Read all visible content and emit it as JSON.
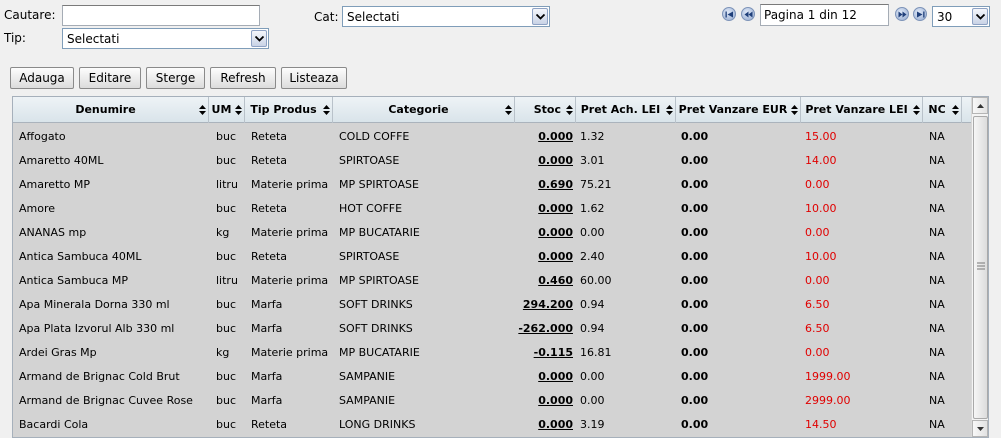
{
  "filters": {
    "search_label": "Cautare:",
    "search_value": "",
    "type_label": "Tip:",
    "type_value": "Selectati",
    "cat_label": "Cat:",
    "cat_value": "Selectati"
  },
  "pager": {
    "page_text": "Pagina 1 din 12",
    "page_size": "30"
  },
  "toolbar": {
    "add": "Adauga",
    "edit": "Editare",
    "delete": "Sterge",
    "refresh": "Refresh",
    "list": "Listeaza"
  },
  "columns": {
    "denumire": "Denumire",
    "um": "UM",
    "tip": "Tip Produs",
    "categorie": "Categorie",
    "stoc": "Stoc",
    "pret_ach": "Pret Ach. LEI",
    "pret_eur": "Pret Vanzare EUR",
    "pret_lei": "Pret Vanzare LEI",
    "nc": "NC"
  },
  "rows": [
    {
      "denumire": "Affogato",
      "um": "buc",
      "tip": "Reteta",
      "categorie": "COLD COFFE",
      "stoc": "0.000",
      "pret_ach": "1.32",
      "pret_eur": "0.00",
      "pret_lei": "15.00",
      "nc": "NA"
    },
    {
      "denumire": "Amaretto 40ML",
      "um": "buc",
      "tip": "Reteta",
      "categorie": "SPIRTOASE",
      "stoc": "0.000",
      "pret_ach": "3.01",
      "pret_eur": "0.00",
      "pret_lei": "14.00",
      "nc": "NA"
    },
    {
      "denumire": "Amaretto MP",
      "um": "litru",
      "tip": "Materie prima",
      "categorie": "MP SPIRTOASE",
      "stoc": "0.690",
      "pret_ach": "75.21",
      "pret_eur": "0.00",
      "pret_lei": "0.00",
      "nc": "NA"
    },
    {
      "denumire": "Amore",
      "um": "buc",
      "tip": "Reteta",
      "categorie": "HOT COFFE",
      "stoc": "0.000",
      "pret_ach": "1.62",
      "pret_eur": "0.00",
      "pret_lei": "10.00",
      "nc": "NA"
    },
    {
      "denumire": "ANANAS mp",
      "um": "kg",
      "tip": "Materie prima",
      "categorie": "MP BUCATARIE",
      "stoc": "0.000",
      "pret_ach": "0.00",
      "pret_eur": "0.00",
      "pret_lei": "0.00",
      "nc": "NA"
    },
    {
      "denumire": "Antica Sambuca 40ML",
      "um": "buc",
      "tip": "Reteta",
      "categorie": "SPIRTOASE",
      "stoc": "0.000",
      "pret_ach": "2.40",
      "pret_eur": "0.00",
      "pret_lei": "10.00",
      "nc": "NA"
    },
    {
      "denumire": "Antica Sambuca MP",
      "um": "litru",
      "tip": "Materie prima",
      "categorie": "MP SPIRTOASE",
      "stoc": "0.460",
      "pret_ach": "60.00",
      "pret_eur": "0.00",
      "pret_lei": "0.00",
      "nc": "NA"
    },
    {
      "denumire": "Apa Minerala Dorna 330 ml",
      "um": "buc",
      "tip": "Marfa",
      "categorie": "SOFT DRINKS",
      "stoc": "294.200",
      "pret_ach": "0.94",
      "pret_eur": "0.00",
      "pret_lei": "6.50",
      "nc": "NA"
    },
    {
      "denumire": "Apa Plata Izvorul Alb 330 ml",
      "um": "buc",
      "tip": "Marfa",
      "categorie": "SOFT DRINKS",
      "stoc": "-262.000",
      "pret_ach": "0.94",
      "pret_eur": "0.00",
      "pret_lei": "6.50",
      "nc": "NA"
    },
    {
      "denumire": "Ardei Gras Mp",
      "um": "kg",
      "tip": "Materie prima",
      "categorie": "MP BUCATARIE",
      "stoc": "-0.115",
      "pret_ach": "16.81",
      "pret_eur": "0.00",
      "pret_lei": "0.00",
      "nc": "NA"
    },
    {
      "denumire": "Armand de Brignac Cold Brut",
      "um": "buc",
      "tip": "Marfa",
      "categorie": "SAMPANIE",
      "stoc": "0.000",
      "pret_ach": "0.00",
      "pret_eur": "0.00",
      "pret_lei": "1999.00",
      "nc": "NA"
    },
    {
      "denumire": "Armand de Brignac Cuvee Rose",
      "um": "buc",
      "tip": "Marfa",
      "categorie": "SAMPANIE",
      "stoc": "0.000",
      "pret_ach": "0.00",
      "pret_eur": "0.00",
      "pret_lei": "2999.00",
      "nc": "NA"
    },
    {
      "denumire": "Bacardi Cola",
      "um": "buc",
      "tip": "Reteta",
      "categorie": "LONG DRINKS",
      "stoc": "0.000",
      "pret_ach": "3.19",
      "pret_eur": "0.00",
      "pret_lei": "14.50",
      "nc": "NA"
    }
  ],
  "icons": {
    "first": "first-page-icon",
    "prev": "prev-page-icon",
    "next": "next-page-icon",
    "last": "last-page-icon",
    "dropdown": "chevron-down-icon",
    "sort": "sort-icon"
  },
  "colors": {
    "price_lei": "#e00000",
    "header_bg": "#e4ecf0",
    "grid_bg": "#d3d3d3"
  }
}
